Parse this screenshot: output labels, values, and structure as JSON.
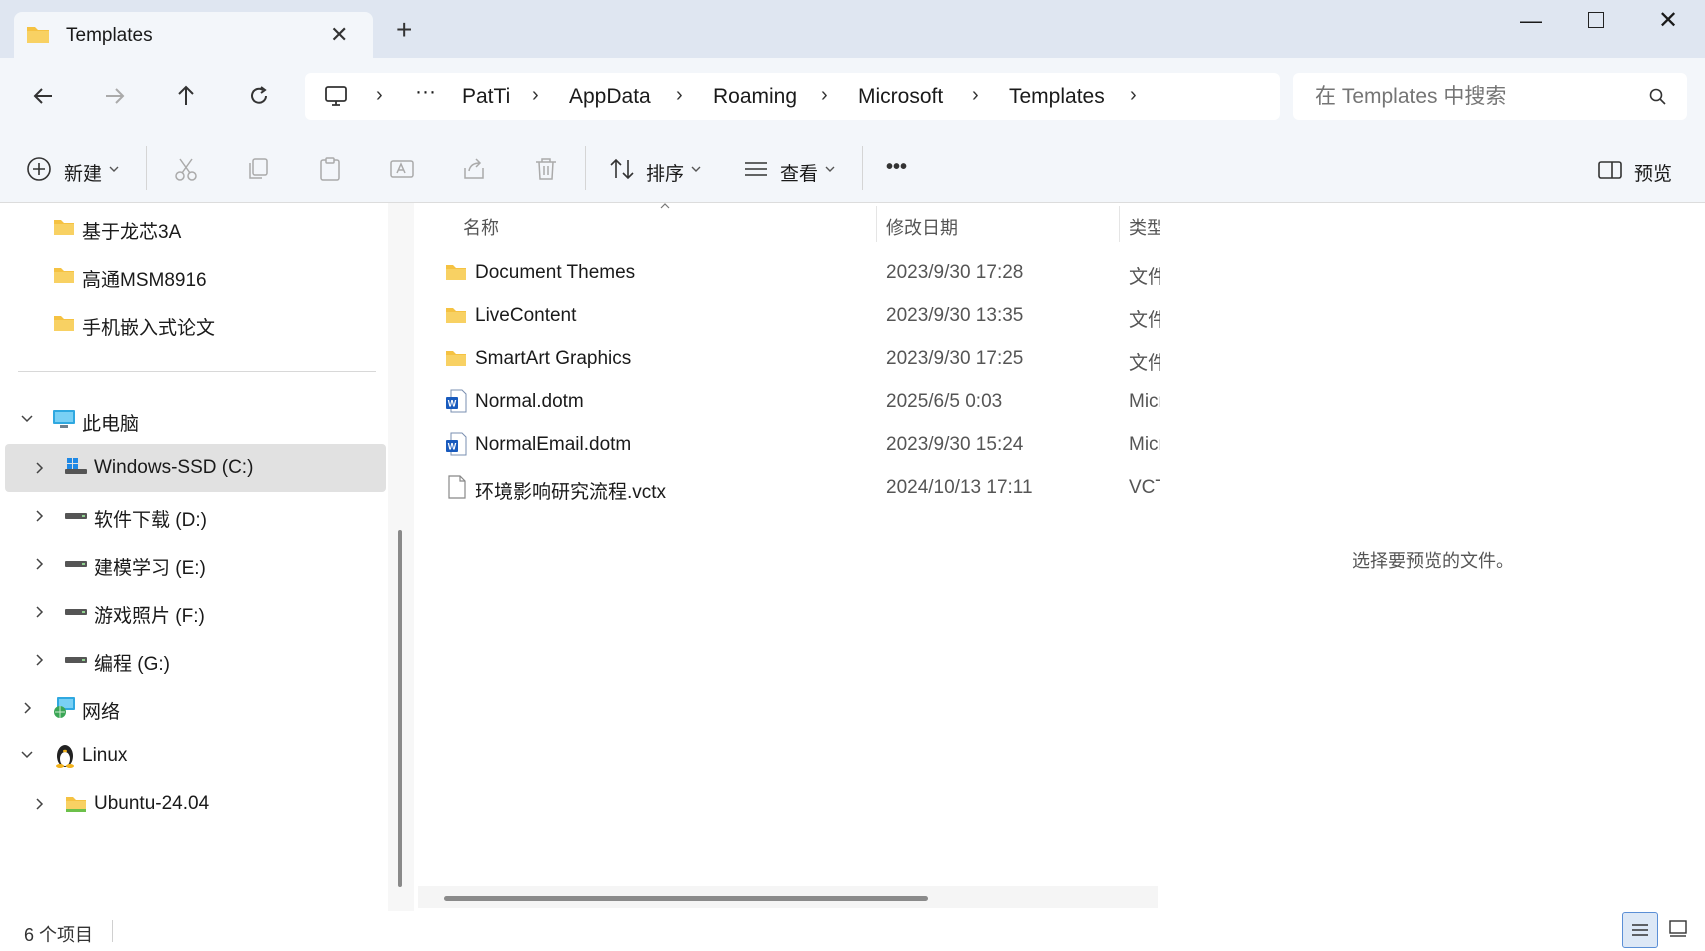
{
  "window": {
    "tab_title": "Templates",
    "tab_close": "✕",
    "new_tab": "+",
    "min": "—",
    "close": "✕"
  },
  "nav": {
    "breadcrumb": {
      "overflow": "···",
      "items": [
        "PatTi",
        "AppData",
        "Roaming",
        "Microsoft",
        "Templates"
      ],
      "separator": "›"
    },
    "search": {
      "placeholder": "在 Templates 中搜索"
    }
  },
  "toolbar": {
    "new_label": "新建",
    "sort_label": "排序",
    "view_label": "查看",
    "more": "•••",
    "preview_label": "预览"
  },
  "sidebar": {
    "folders": [
      "基于龙芯3A",
      "高通MSM8916",
      "手机嵌入式论文"
    ],
    "this_pc": "此电脑",
    "drives": [
      "Windows-SSD (C:)",
      "软件下载 (D:)",
      "建模学习 (E:)",
      "游戏照片 (F:)",
      "编程 (G:)"
    ],
    "network": "网络",
    "linux": "Linux",
    "linux_child": "Ubuntu-24.04"
  },
  "file_list": {
    "columns": [
      "名称",
      "修改日期",
      "类型"
    ],
    "rows": [
      {
        "name": "Document Themes",
        "date": "2023/9/30 17:28",
        "type": "文件夹",
        "icon": "folder-icon"
      },
      {
        "name": "LiveContent",
        "date": "2023/9/30 13:35",
        "type": "文件夹",
        "icon": "folder-icon"
      },
      {
        "name": "SmartArt Graphics",
        "date": "2023/9/30 17:25",
        "type": "文件夹",
        "icon": "folder-icon"
      },
      {
        "name": "Normal.dotm",
        "date": "2025/6/5 0:03",
        "type": "Microsoft",
        "icon": "word-doc-icon"
      },
      {
        "name": "NormalEmail.dotm",
        "date": "2023/9/30 15:24",
        "type": "Microsoft",
        "icon": "word-doc-icon"
      },
      {
        "name": "环境影响研究流程.vctx",
        "date": "2024/10/13 17:11",
        "type": "VCTX",
        "icon": "blank-file-icon"
      }
    ]
  },
  "preview": {
    "message": "选择要预览的文件。"
  },
  "status": {
    "count": "6 个项目"
  },
  "colors": {
    "folder": "#f5c242",
    "accent": "#0067c0",
    "word": "#185abd",
    "selected": "#e1e1e1"
  }
}
